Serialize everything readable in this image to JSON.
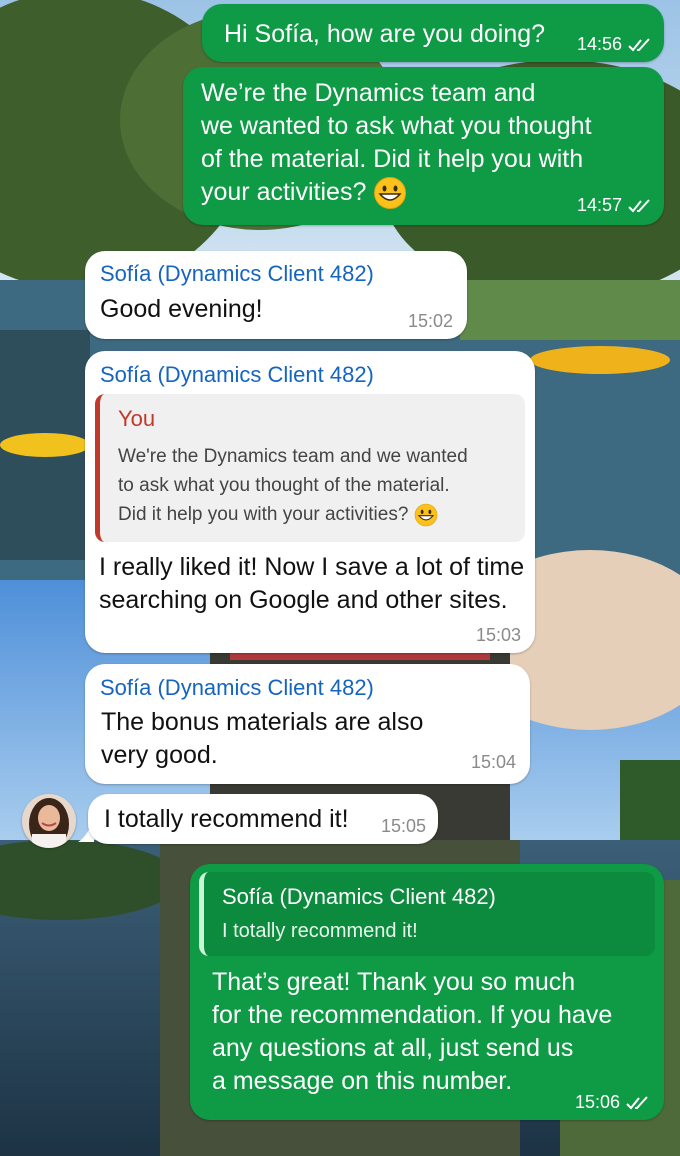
{
  "chat": {
    "messages": [
      {
        "direction": "outgoing",
        "text": "Hi Sofía, how are you doing?",
        "time": "14:56",
        "status": "read-double-check-icon"
      },
      {
        "direction": "outgoing",
        "lines": [
          "We’re the Dynamics team and",
          "we wanted to ask what you thought",
          "of the material. Did it help you with",
          "your activities?"
        ],
        "emoji": "grinning-face-emoji",
        "time": "14:57",
        "status": "read-double-check-icon"
      },
      {
        "direction": "incoming",
        "sender": "Sofía (Dynamics Client 482)",
        "text": "Good evening!",
        "time": "15:02"
      },
      {
        "direction": "incoming",
        "sender": "Sofía (Dynamics Client 482)",
        "quote": {
          "author": "You",
          "lines": [
            "We're the Dynamics team and we wanted",
            "to ask what you thought of the material.",
            "Did it help you with your activities?"
          ],
          "emoji": "grinning-face-emoji"
        },
        "lines": [
          "I really liked it! Now I save a lot of time",
          "searching on Google and other sites."
        ],
        "time": "15:03"
      },
      {
        "direction": "incoming",
        "sender": "Sofía (Dynamics Client 482)",
        "lines": [
          "The bonus materials are also",
          "very good."
        ],
        "time": "15:04"
      },
      {
        "direction": "incoming",
        "text": "I totally recommend it!",
        "time": "15:05",
        "avatar": "contact-avatar"
      },
      {
        "direction": "outgoing",
        "quote": {
          "author": "Sofía (Dynamics Client 482)",
          "text": "I totally recommend it!"
        },
        "lines": [
          "That’s great! Thank you so much",
          "for the recommendation. If you have",
          "any questions at all, just send us",
          "a message on this number."
        ],
        "time": "15:06",
        "status": "read-double-check-icon"
      }
    ]
  },
  "colors": {
    "outgoing_bubble": "#0f9a45",
    "incoming_bubble": "#ffffff",
    "sender_name": "#1565c0",
    "quote_author_you": "#c0392b"
  }
}
